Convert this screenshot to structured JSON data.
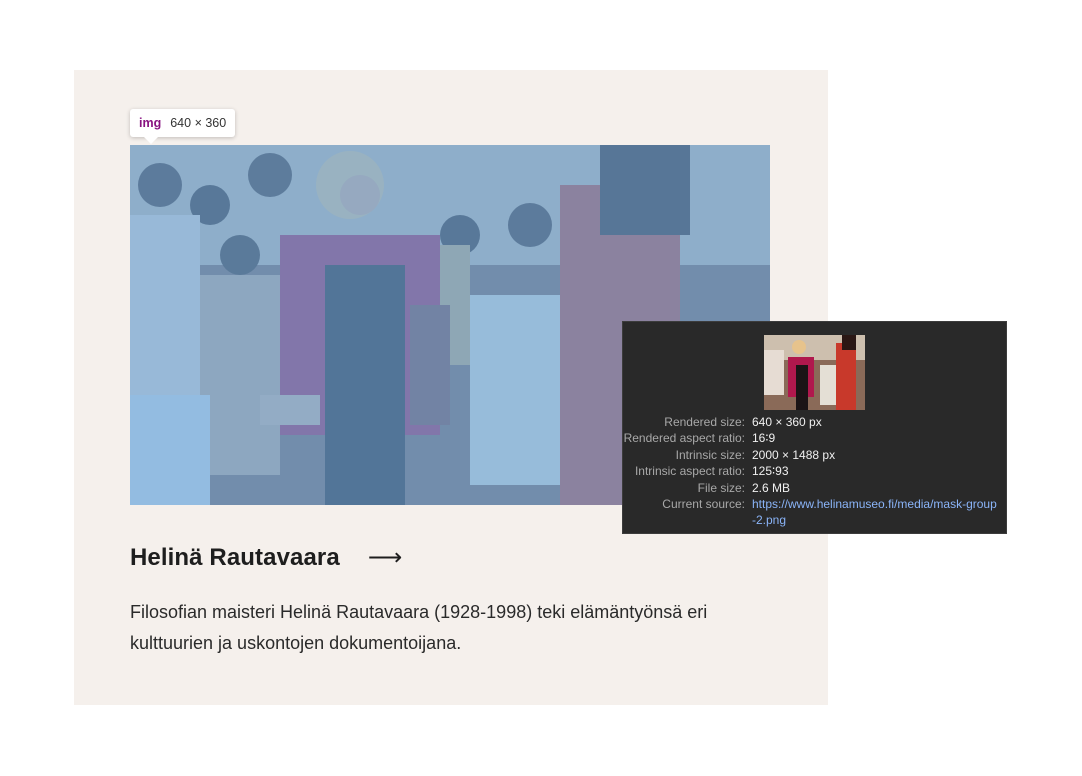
{
  "card": {
    "title": "Helinä Rautavaara",
    "arrow": "⟶",
    "description": "Filosofian maisteri Helinä Rautavaara (1928-1998) teki elämäntyönsä eri kulttuurien ja uskontojen dokumentoijana."
  },
  "badge": {
    "tag": "img",
    "dimensions": "640 × 360"
  },
  "tooltip": {
    "rows": [
      {
        "key": "Rendered size:",
        "value": "640 × 360 px"
      },
      {
        "key": "Rendered aspect ratio:",
        "value": "16∶9"
      },
      {
        "key": "Intrinsic size:",
        "value": "2000 × 1488 px"
      },
      {
        "key": "Intrinsic aspect ratio:",
        "value": "125∶93"
      },
      {
        "key": "File size:",
        "value": "2.6 MB"
      },
      {
        "key": "Current source:",
        "value": "https://www.helinamuseo.fi/media/mask-group-2.png"
      }
    ]
  },
  "colors": {
    "card_bg": "#f5f0ec",
    "highlight": "#6fa8dc",
    "tooltip_bg": "#292929",
    "link": "#8ab4f8",
    "tag": "#881280"
  }
}
